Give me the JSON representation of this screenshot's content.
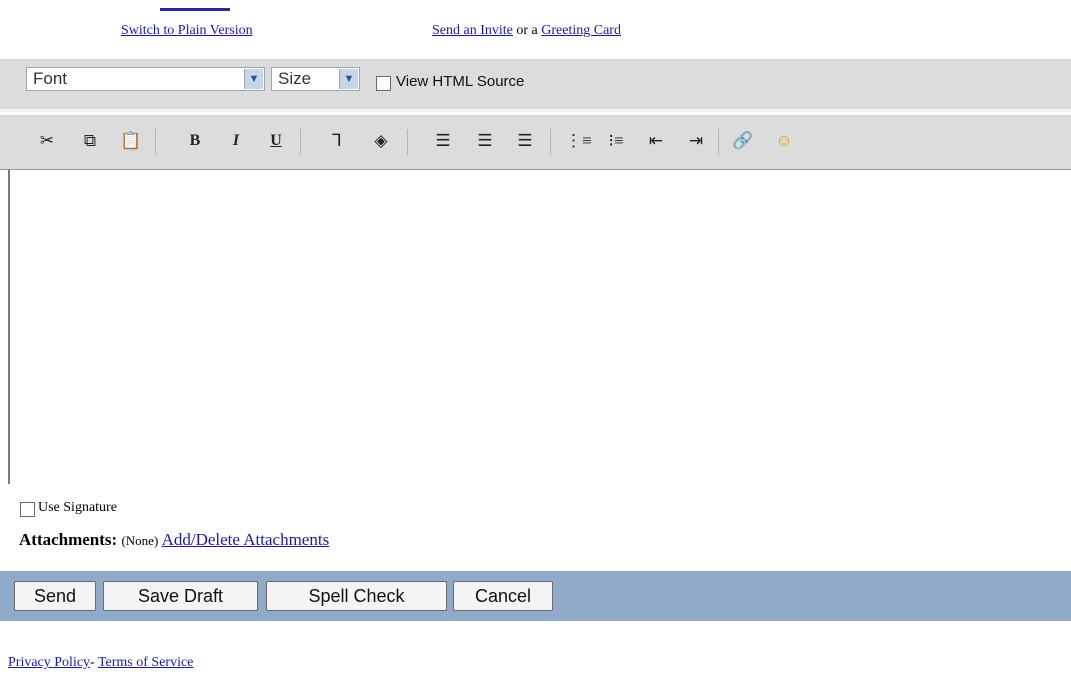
{
  "top_links": {
    "switch_plain": "Switch to Plain Version",
    "send_invite": "Send an Invite",
    "or_a": "or a",
    "greeting_card": "Greeting Card"
  },
  "font_bar": {
    "font_value": "Font",
    "size_value": "Size",
    "view_html_label": "View HTML Source"
  },
  "toolbar": {
    "icons": [
      "cut-icon",
      "copy-icon",
      "paste-icon",
      "bold-icon",
      "italic-icon",
      "underline-icon",
      "text-color-icon",
      "highlight-color-icon",
      "align-left-icon",
      "align-center-icon",
      "align-right-icon",
      "numbered-list-icon",
      "bulleted-list-icon",
      "outdent-icon",
      "indent-icon",
      "web-link-icon",
      "emoticon-icon"
    ],
    "bold_glyph": "B",
    "italic_glyph": "I",
    "underline_glyph": "U"
  },
  "editor": {
    "body_text": ""
  },
  "signature": {
    "label": "Use Signature",
    "checked": false
  },
  "attachments": {
    "label": "Attachments:",
    "status": "(None)",
    "link": "Add/Delete Attachments"
  },
  "buttons": {
    "send": "Send",
    "save_draft": "Save Draft",
    "spell_check": "Spell Check",
    "cancel": "Cancel"
  },
  "footer": {
    "privacy": "Privacy Policy",
    "separator": "-",
    "terms": "Terms of Service"
  },
  "colors": {
    "toolbar_bg": "#dcdcdc",
    "button_bar_bg": "#8fa9c9",
    "link": "#1a1aa6"
  }
}
